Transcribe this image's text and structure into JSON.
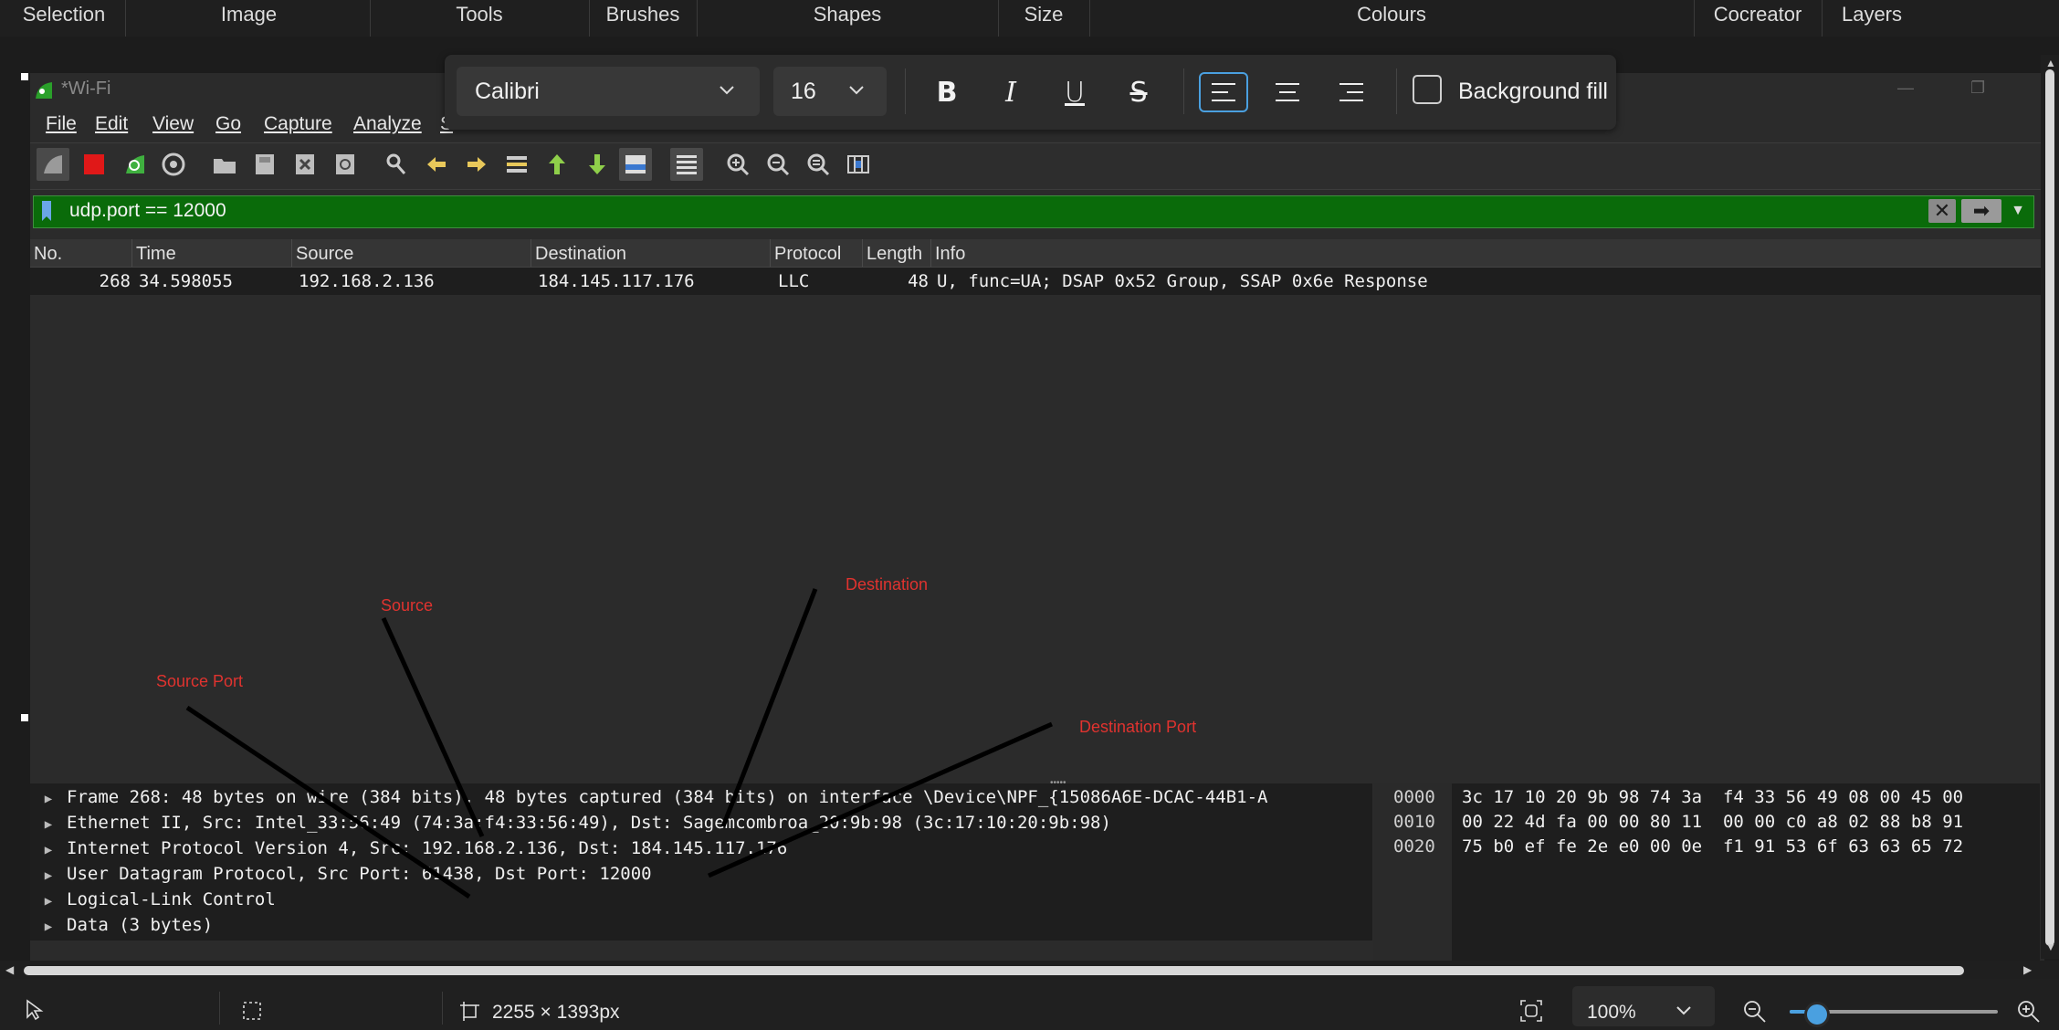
{
  "ribbon": {
    "items": [
      "Selection",
      "Image",
      "Tools",
      "Brushes",
      "Shapes",
      "Size",
      "Colours",
      "Cocreator",
      "Layers"
    ]
  },
  "wireshark": {
    "title": "*Wi-Fi",
    "menu": [
      "File",
      "Edit",
      "View",
      "Go",
      "Capture",
      "Analyze",
      "S"
    ],
    "filter": "udp.port == 12000",
    "columns": [
      "No.",
      "Time",
      "Source",
      "Destination",
      "Protocol",
      "Length",
      "Info"
    ],
    "packet": {
      "no": "268",
      "time": "34.598055",
      "source": "192.168.2.136",
      "destination": "184.145.117.176",
      "protocol": "LLC",
      "length": "48",
      "info": "U, func=UA; DSAP 0x52 Group, SSAP 0x6e Response"
    },
    "details": [
      "Frame 268: 48 bytes on wire (384 bits), 48 bytes captured (384 bits) on interface \\Device\\NPF_{15086A6E-DCAC-44B1-A",
      "Ethernet II, Src: Intel_33:56:49 (74:3a:f4:33:56:49), Dst: Sagemcombroa_20:9b:98 (3c:17:10:20:9b:98)",
      "Internet Protocol Version 4, Src: 192.168.2.136, Dst: 184.145.117.176",
      "User Datagram Protocol, Src Port: 61438, Dst Port: 12000",
      "Logical-Link Control",
      "Data (3 bytes)"
    ],
    "hex": [
      {
        "offset": "0000",
        "bytes": "3c 17 10 20 9b 98 74 3a  f4 33 56 49 08 00 45 00"
      },
      {
        "offset": "0010",
        "bytes": "00 22 4d fa 00 00 80 11  00 00 c0 a8 02 88 b8 91"
      },
      {
        "offset": "0020",
        "bytes": "75 b0 ef fe 2e e0 00 0e  f1 91 53 6f 63 63 65 72"
      }
    ]
  },
  "text_toolbar": {
    "font": "Calibri",
    "size": "16",
    "bold": "B",
    "italic": "I",
    "underline": "U",
    "strike": "S",
    "background_fill": "Background fill"
  },
  "annotations": {
    "source": "Source",
    "destination": "Destination",
    "source_port": "Source Port",
    "destination_port": "Destination Port"
  },
  "statusbar": {
    "canvas_size": "2255 × 1393px",
    "zoom": "100%",
    "zoom_value": 0.08
  },
  "colors": {
    "filter_bg": "#0a6b0a",
    "accent": "#4aa0e0",
    "annotation": "#e0332f"
  }
}
